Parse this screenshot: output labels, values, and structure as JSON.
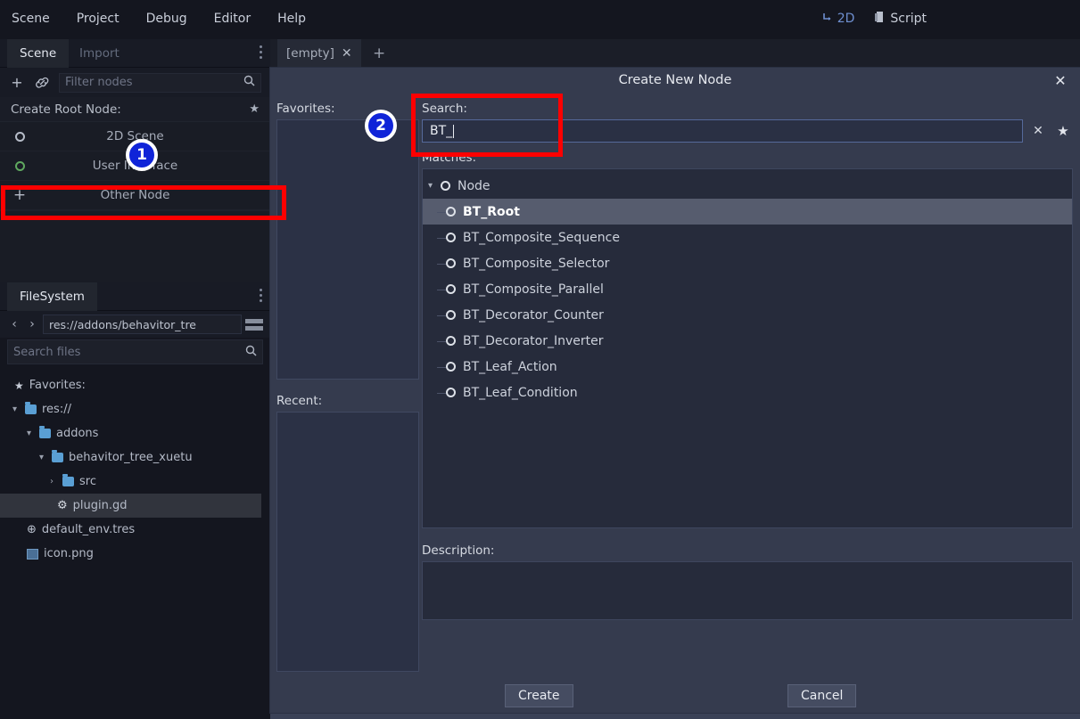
{
  "menubar": {
    "items": [
      "Scene",
      "Project",
      "Debug",
      "Editor",
      "Help"
    ],
    "right_buttons": [
      {
        "label": "2D",
        "icon": "2d-view-icon"
      },
      {
        "label": "Script",
        "icon": "script-icon"
      }
    ]
  },
  "scene_dock": {
    "tabs": [
      {
        "label": "Scene",
        "active": true
      },
      {
        "label": "Import",
        "active": false
      }
    ],
    "toolbar": {
      "add_icon": "plus-icon",
      "link_icon": "link-icon",
      "filter_placeholder": "Filter nodes",
      "search_icon": "search-icon"
    },
    "create_root_header": "Create Root Node:",
    "root_options": [
      {
        "label": "2D Scene",
        "icon": "circle-icon"
      },
      {
        "label": "User Interface",
        "icon": "circle-green-icon"
      },
      {
        "label": "Other Node",
        "icon": "plus-icon"
      }
    ]
  },
  "filesystem_dock": {
    "tab_label": "FileSystem",
    "path": "res://addons/behavitor_tre",
    "search_placeholder": "Search files",
    "tree": [
      {
        "label": "Favorites:",
        "icon": "star-icon",
        "indent": 0,
        "twisty": "",
        "selected": false
      },
      {
        "label": "res://",
        "icon": "folder-icon",
        "indent": 0,
        "twisty": "v",
        "selected": false
      },
      {
        "label": "addons",
        "icon": "folder-icon",
        "indent": 1,
        "twisty": "v",
        "selected": false
      },
      {
        "label": "behavitor_tree_xuetu",
        "icon": "folder-icon",
        "indent": 2,
        "twisty": "v",
        "selected": false
      },
      {
        "label": "src",
        "icon": "folder-icon",
        "indent": 3,
        "twisty": ">",
        "selected": false
      },
      {
        "label": "plugin.gd",
        "icon": "gear-icon",
        "indent": 3,
        "twisty": "",
        "selected": true
      },
      {
        "label": "default_env.tres",
        "icon": "globe-icon",
        "indent": 1,
        "twisty": "",
        "selected": false
      },
      {
        "label": "icon.png",
        "icon": "image-icon",
        "indent": 1,
        "twisty": "",
        "selected": false
      }
    ]
  },
  "viewport": {
    "tab_label": "[empty]",
    "tab_close_icon": "close-icon",
    "add_tab_icon": "plus-icon"
  },
  "dialog": {
    "title": "Create New Node",
    "close_icon": "close-icon",
    "favorites_label": "Favorites:",
    "recent_label": "Recent:",
    "search_label": "Search:",
    "search_value": "BT_",
    "search_clear_icon": "clear-icon",
    "search_favorite_icon": "star-icon",
    "matches_label": "Matches:",
    "matches": [
      {
        "label": "Node",
        "level": 0,
        "selected": false,
        "twisty": "v"
      },
      {
        "label": "BT_Root",
        "level": 1,
        "selected": true,
        "twisty": ""
      },
      {
        "label": "BT_Composite_Sequence",
        "level": 1,
        "selected": false,
        "twisty": ""
      },
      {
        "label": "BT_Composite_Selector",
        "level": 1,
        "selected": false,
        "twisty": ""
      },
      {
        "label": "BT_Composite_Parallel",
        "level": 1,
        "selected": false,
        "twisty": ""
      },
      {
        "label": "BT_Decorator_Counter",
        "level": 1,
        "selected": false,
        "twisty": ""
      },
      {
        "label": "BT_Decorator_Inverter",
        "level": 1,
        "selected": false,
        "twisty": ""
      },
      {
        "label": "BT_Leaf_Action",
        "level": 1,
        "selected": false,
        "twisty": ""
      },
      {
        "label": "BT_Leaf_Condition",
        "level": 1,
        "selected": false,
        "twisty": ""
      }
    ],
    "description_label": "Description:",
    "description_value": "",
    "create_button": "Create",
    "cancel_button": "Cancel"
  },
  "annotations": {
    "highlight_color": "#fe0000",
    "badge_color": "#1024d8",
    "badges": [
      {
        "label": "1",
        "target": "other-node-row"
      },
      {
        "label": "2",
        "target": "search-field"
      }
    ]
  }
}
